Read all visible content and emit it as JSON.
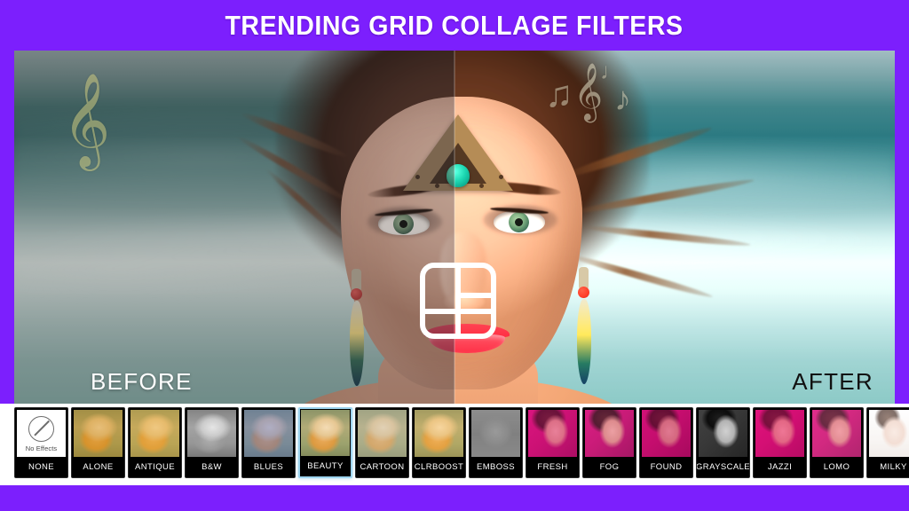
{
  "header": {
    "title": "TRENDING GRID COLLAGE FILTERS",
    "background_color": "#7c1ffd",
    "text_color": "#ffffff"
  },
  "stage": {
    "compare_labels": {
      "before": "BEFORE",
      "after": "AFTER"
    },
    "before_label_color": "#ffffff",
    "after_label_color": "#111111",
    "overlay_icon": "grid-collage-icon",
    "watermarks": [
      {
        "name": "treble-clef-watermark",
        "glyph": "𝄞"
      },
      {
        "name": "treble-clef-small-watermark",
        "glyph": "𝄞"
      },
      {
        "name": "beamed-notes-watermark",
        "glyph": "♫"
      },
      {
        "name": "eighth-note-watermark",
        "glyph": "♪"
      },
      {
        "name": "quarter-note-watermark",
        "glyph": "♩"
      }
    ]
  },
  "filter_strip": {
    "selected": "BEATY_INDEX_5",
    "selected_index": 5,
    "selected_border_color": "#9dd4ef",
    "items": [
      {
        "label": "NONE",
        "style": "none",
        "no_effects_text": "No Effects"
      },
      {
        "label": "ALONE",
        "style": "blonde",
        "tint": "rgba(214,150,40,0.42)"
      },
      {
        "label": "ANTIQUE",
        "style": "blonde",
        "tint": "rgba(236,176,70,0.46)"
      },
      {
        "label": "B&W",
        "style": "blonde",
        "tint": "grayscale"
      },
      {
        "label": "BLUES",
        "style": "blonde",
        "tint": "rgba(96,120,214,0.46)"
      },
      {
        "label": "BEAUTY",
        "style": "blonde",
        "tint": "rgba(255,225,190,0.12)"
      },
      {
        "label": "CARTOON",
        "style": "blonde",
        "tint": "rgba(205,196,182,0.45)"
      },
      {
        "label": "CLRBOOST",
        "style": "blonde",
        "tint": "rgba(255,200,110,0.30)"
      },
      {
        "label": "EMBOSS",
        "style": "emboss",
        "tint": "rgba(140,140,140,0.20)"
      },
      {
        "label": "FRESH",
        "style": "glam",
        "tint": "rgba(220,20,130,0.38)"
      },
      {
        "label": "FOG",
        "style": "glam",
        "tint": "rgba(225,60,150,0.26)"
      },
      {
        "label": "FOUND",
        "style": "glam",
        "tint": "rgba(200,10,110,0.40)"
      },
      {
        "label": "GRAYSCALE",
        "style": "glam",
        "tint": "grayscale"
      },
      {
        "label": "JAZZI",
        "style": "glam",
        "tint": "rgba(235,15,125,0.42)"
      },
      {
        "label": "LOMO",
        "style": "glam",
        "tint": "rgba(240,90,165,0.34)"
      },
      {
        "label": "MILKY",
        "style": "milky",
        "tint": "rgba(255,255,255,0.30)"
      },
      {
        "label": "",
        "style": "dark",
        "tint": "rgba(0,0,0,0.10)"
      }
    ]
  }
}
